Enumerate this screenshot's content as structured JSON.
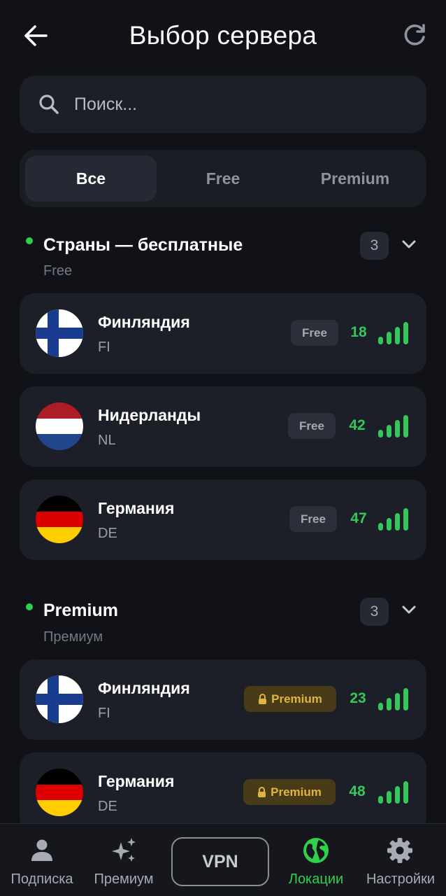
{
  "header": {
    "title": "Выбор сервера",
    "back_icon": "arrow-left-icon",
    "refresh_icon": "refresh-icon"
  },
  "search": {
    "placeholder": "Поиск...",
    "value": "",
    "icon": "search-icon"
  },
  "filter_tabs": [
    {
      "label": "Все",
      "active": true
    },
    {
      "label": "Free",
      "active": false
    },
    {
      "label": "Premium",
      "active": false
    }
  ],
  "sections": [
    {
      "title": "Страны — бесплатные",
      "subtitle": "Free",
      "count": "3",
      "servers": [
        {
          "name": "Финляндия",
          "code": "FI",
          "tier": "Free",
          "ping": "18",
          "flag": "finland-flag"
        },
        {
          "name": "Нидерланды",
          "code": "NL",
          "tier": "Free",
          "ping": "42",
          "flag": "netherlands-flag"
        },
        {
          "name": "Германия",
          "code": "DE",
          "tier": "Free",
          "ping": "47",
          "flag": "germany-flag"
        }
      ]
    },
    {
      "title": "Premium",
      "subtitle": "Премиум",
      "count": "3",
      "servers": [
        {
          "name": "Финляндия",
          "code": "FI",
          "tier": "Premium",
          "ping": "23",
          "flag": "finland-flag"
        },
        {
          "name": "Германия",
          "code": "DE",
          "tier": "Premium",
          "ping": "48",
          "flag": "germany-flag"
        }
      ]
    }
  ],
  "bottom_nav": {
    "items": [
      {
        "label": "Подписка",
        "icon": "person-icon",
        "active": false
      },
      {
        "label": "Премиум",
        "icon": "sparkles-icon",
        "active": false
      },
      {
        "label": "Локации",
        "icon": "globe-icon",
        "active": true
      },
      {
        "label": "Настройки",
        "icon": "gear-icon",
        "active": false
      }
    ],
    "center_button": "VPN"
  },
  "colors": {
    "background": "#101218",
    "card": "#1c1f27",
    "accent_green": "#2fd04a",
    "ping_green": "#34c759",
    "premium_gold": "#e3b342"
  }
}
